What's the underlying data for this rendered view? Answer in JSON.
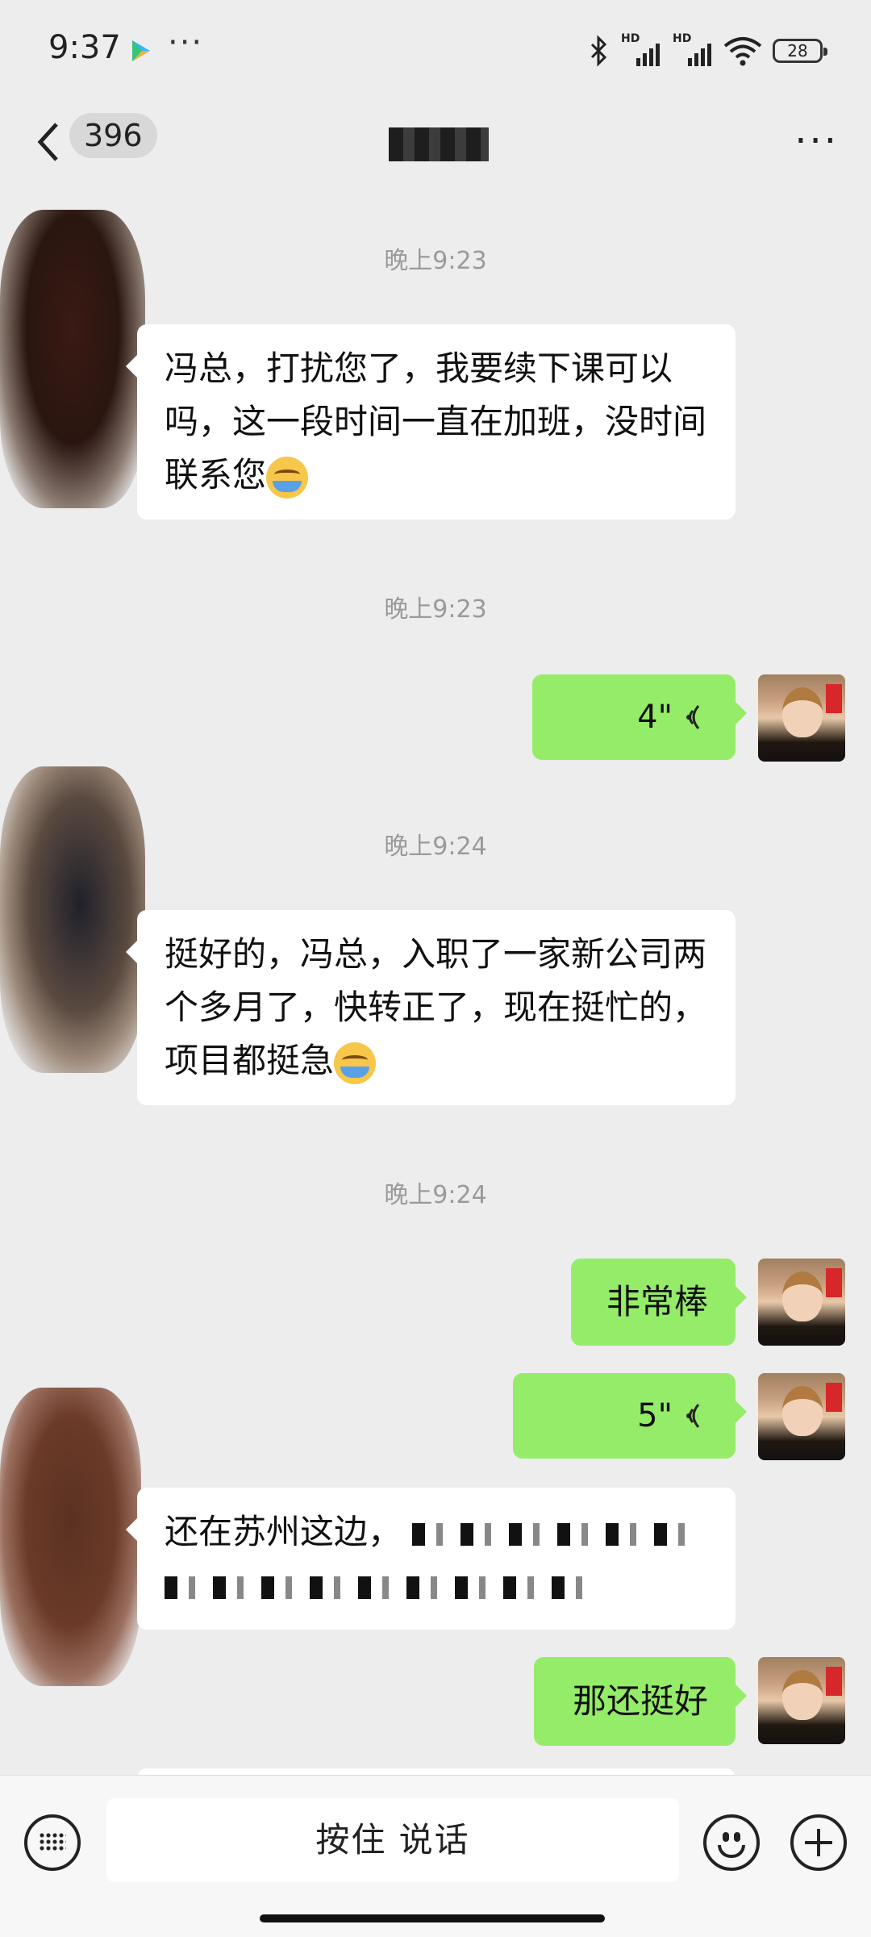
{
  "status_bar": {
    "time": "9:37",
    "more": "···",
    "battery": "28"
  },
  "nav": {
    "unread_count": "396",
    "title": "",
    "menu": "···"
  },
  "messages": [
    {
      "type": "timestamp",
      "text": "晚上9:23"
    },
    {
      "type": "text",
      "direction": "in",
      "text": "冯总，打扰您了，我要续下课可以吗，这一段时间一直在加班，没时间联系您",
      "emoji": "crying-laughing-emoji"
    },
    {
      "type": "timestamp",
      "text": "晚上9:23"
    },
    {
      "type": "voice",
      "direction": "out",
      "duration": "4\""
    },
    {
      "type": "timestamp",
      "text": "晚上9:24"
    },
    {
      "type": "text",
      "direction": "in",
      "text": "挺好的，冯总，入职了一家新公司两个多月了，快转正了，现在挺忙的，项目都挺急",
      "emoji": "crying-laughing-emoji"
    },
    {
      "type": "timestamp",
      "text": "晚上9:24"
    },
    {
      "type": "text",
      "direction": "out",
      "text": "非常棒"
    },
    {
      "type": "voice",
      "direction": "out",
      "duration": "5\""
    },
    {
      "type": "text",
      "direction": "in",
      "text": "还在苏州这边，"
    },
    {
      "type": "text",
      "direction": "out",
      "text": "那还挺好"
    }
  ],
  "input_bar": {
    "hold_to_talk": "按住 说话"
  },
  "colors": {
    "background": "#ededed",
    "out_bubble": "#95ec69",
    "in_bubble": "#ffffff",
    "timestamp": "#9a9a9a"
  }
}
